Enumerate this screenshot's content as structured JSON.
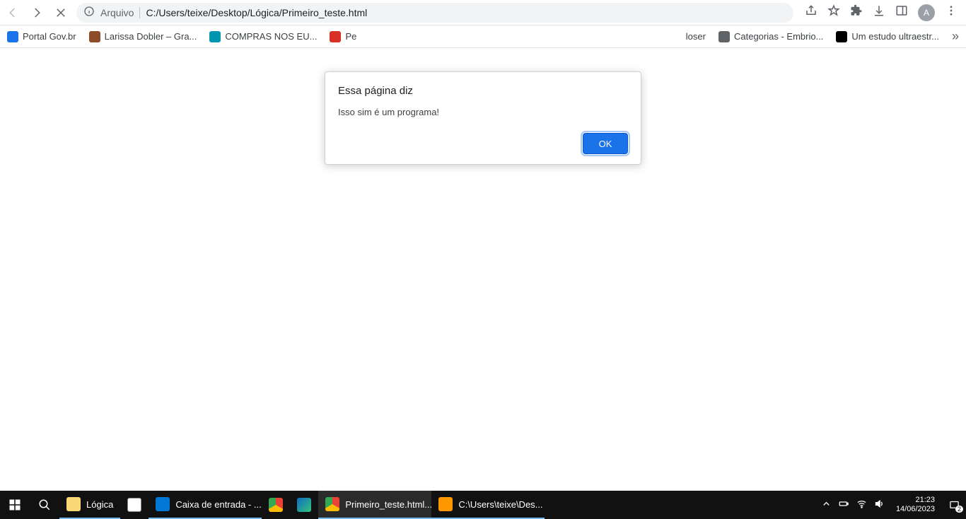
{
  "toolbar": {
    "file_label": "Arquivo",
    "url": "C:/Users/teixe/Desktop/Lógica/Primeiro_teste.html",
    "avatar_letter": "A"
  },
  "bookmarks": [
    {
      "label": "Portal Gov.br",
      "color": "fc-blue"
    },
    {
      "label": "Larissa Dobler – Gra...",
      "color": "fc-brown"
    },
    {
      "label": "COMPRAS NOS EU...",
      "color": "fc-teal"
    },
    {
      "label": "Pe",
      "color": "fc-red"
    },
    {
      "label": "loser",
      "color": "fc-green"
    },
    {
      "label": "Categorias - Embrio...",
      "color": "fc-grey"
    },
    {
      "label": "Um estudo ultraestr...",
      "color": "fc-black"
    }
  ],
  "alert": {
    "title": "Essa página diz",
    "message": "Isso sim é um programa!",
    "ok_label": "OK"
  },
  "taskbar": {
    "explorer_label": "Lógica",
    "apps": [
      {
        "label": "",
        "cls": "fc-store"
      },
      {
        "label": "Caixa de entrada - ...",
        "cls": "fc-mail"
      },
      {
        "label": "",
        "cls": "fc-chrome"
      },
      {
        "label": "",
        "cls": "fc-edge"
      },
      {
        "label": "Primeiro_teste.html...",
        "cls": "fc-chrome",
        "active": true
      },
      {
        "label": "C:\\Users\\teixe\\Des...",
        "cls": "fc-sublime"
      }
    ],
    "time": "21:23",
    "date": "14/06/2023",
    "notif_count": "2"
  }
}
